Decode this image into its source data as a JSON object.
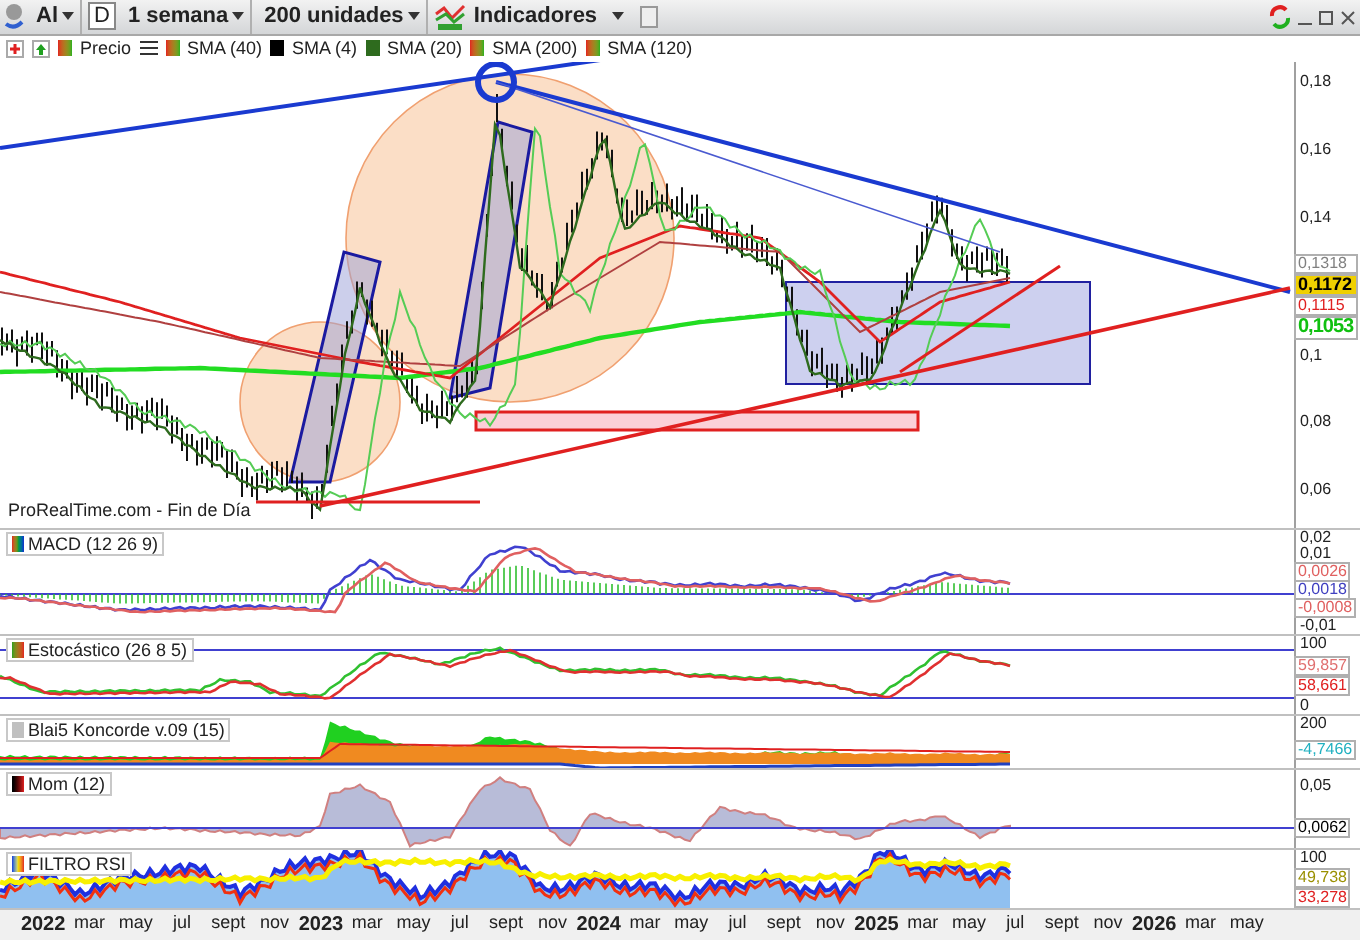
{
  "toolbar": {
    "instrument": "Al",
    "period_key": "D",
    "timeframe": "1 semana",
    "units": "200 unidades",
    "indicators": "Indicadores"
  },
  "legend": [
    {
      "label": "Precio",
      "kind": "updown"
    },
    {
      "label": "SMA (40)",
      "kind": "updown"
    },
    {
      "label": "SMA (4)",
      "kind": "solid",
      "color": "#000000"
    },
    {
      "label": "SMA (20)",
      "kind": "solid",
      "color": "#2e6b1e"
    },
    {
      "label": "SMA (200)",
      "kind": "updown"
    },
    {
      "label": "SMA (120)",
      "kind": "updown"
    }
  ],
  "main_chart": {
    "source": "ProRealTime.com - Fin de Día",
    "axis_labels": [
      "0,18",
      "0,16",
      "0,14",
      "0,1",
      "0,08",
      "0,06"
    ],
    "value_tags": [
      {
        "text": "0,1318",
        "color": "#808080",
        "kind": "plain"
      },
      {
        "text": "0,1172",
        "color": "#f0d000",
        "kind": "highlight"
      },
      {
        "text": "0,1115",
        "color": "#e02020",
        "kind": "plain"
      },
      {
        "text": "0,1053",
        "color": "#10c010",
        "kind": "large"
      }
    ]
  },
  "panels": [
    {
      "kind": "macd",
      "title": "MACD (12 26 9)",
      "axis_labels": [
        "0,02",
        "0,01",
        "-0,01"
      ],
      "value_tags": [
        {
          "text": "0,0026",
          "color": "#e06060"
        },
        {
          "text": "0,0018",
          "color": "#4040c0"
        },
        {
          "text": "-0,0008",
          "color": "#e06060"
        }
      ]
    },
    {
      "kind": "stochastic",
      "title": "Estocástico (26 8 5)",
      "axis_labels": [
        "100",
        "0"
      ],
      "value_tags": [
        {
          "text": "59,857",
          "color": "#e07070"
        },
        {
          "text": "58,661",
          "color": "#e02020"
        }
      ]
    },
    {
      "kind": "koncorde",
      "title": "Blai5 Koncorde v.09 (15)",
      "axis_labels": [
        "200"
      ],
      "value_tags": [
        {
          "text": "-4,7466",
          "color": "#20b0c0"
        }
      ]
    },
    {
      "kind": "momentum",
      "title": "Mom (12)",
      "axis_labels": [
        "0,05"
      ],
      "value_tags": [
        {
          "text": "0,0062",
          "color": "#000000"
        }
      ]
    },
    {
      "kind": "rsi",
      "title": "FILTRO RSI",
      "axis_labels": [
        "100"
      ],
      "value_tags": [
        {
          "text": "49,738",
          "color": "#9a9000"
        },
        {
          "text": "33,278",
          "color": "#e02020"
        }
      ]
    }
  ],
  "time_axis": [
    {
      "label": "2022",
      "kind": "year"
    },
    {
      "label": "mar",
      "kind": "month"
    },
    {
      "label": "may",
      "kind": "month"
    },
    {
      "label": "jul",
      "kind": "month"
    },
    {
      "label": "sept",
      "kind": "month"
    },
    {
      "label": "nov",
      "kind": "month"
    },
    {
      "label": "2023",
      "kind": "year"
    },
    {
      "label": "mar",
      "kind": "month"
    },
    {
      "label": "may",
      "kind": "month"
    },
    {
      "label": "jul",
      "kind": "month"
    },
    {
      "label": "sept",
      "kind": "month"
    },
    {
      "label": "nov",
      "kind": "month"
    },
    {
      "label": "2024",
      "kind": "year"
    },
    {
      "label": "mar",
      "kind": "month"
    },
    {
      "label": "may",
      "kind": "month"
    },
    {
      "label": "jul",
      "kind": "month"
    },
    {
      "label": "sept",
      "kind": "month"
    },
    {
      "label": "nov",
      "kind": "month"
    },
    {
      "label": "2025",
      "kind": "year"
    },
    {
      "label": "mar",
      "kind": "month"
    },
    {
      "label": "may",
      "kind": "month"
    },
    {
      "label": "jul",
      "kind": "month"
    },
    {
      "label": "sept",
      "kind": "month"
    },
    {
      "label": "nov",
      "kind": "month"
    },
    {
      "label": "2026",
      "kind": "year"
    },
    {
      "label": "mar",
      "kind": "month"
    },
    {
      "label": "may",
      "kind": "month"
    }
  ]
}
